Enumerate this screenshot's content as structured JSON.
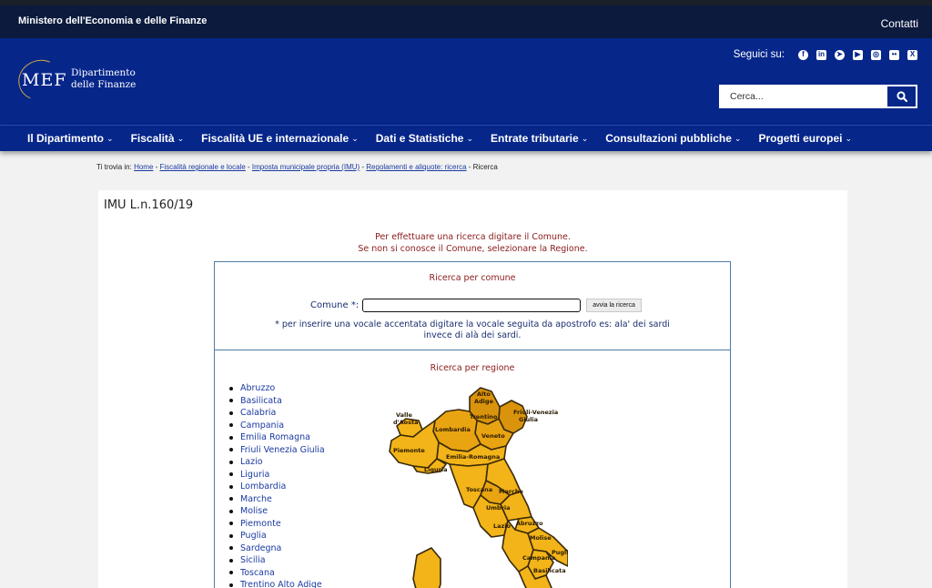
{
  "topbar": {
    "ministry": "Ministero dell'Economia e delle Finanze",
    "contact": "Contatti"
  },
  "header": {
    "logo_text": "MEF",
    "dept_line1": "Dipartimento",
    "dept_line2": "delle Finanze",
    "social_label": "Seguici su:",
    "social_icons": [
      "facebook-icon",
      "linkedin-icon",
      "telegram-icon",
      "youtube-icon",
      "instagram-icon",
      "flickr-icon",
      "x-icon"
    ],
    "search_placeholder": "Cerca..."
  },
  "nav": {
    "items": [
      "Il Dipartimento",
      "Fiscalità",
      "Fiscalità UE e internazionale",
      "Dati e Statistiche",
      "Entrate tributarie",
      "Consultazioni pubbliche",
      "Progetti europei"
    ],
    "chevron": "⌄"
  },
  "breadcrumb": {
    "prefix": "Ti trovia in:",
    "links": [
      "Home",
      "Fiscalità regionale e locale",
      "Imposta municipale propria (IMU)",
      "Regolamenti e aliquote: ricerca"
    ],
    "sep": " - ",
    "current": "Ricerca"
  },
  "page": {
    "title": "IMU L.n.160/19",
    "intro_line1": "Per effettuare una ricerca digitare il Comune.",
    "intro_line2": "Se non si conosce il Comune, selezionare la Regione.",
    "comune_section_title": "Ricerca per comune",
    "comune_label": "Comune *:",
    "comune_value": "",
    "search_button": "avvia la ricerca",
    "note_line1": "* per inserire una vocale accentata digitare la vocale seguita da apostrofo es: ala' dei sardi",
    "note_line2": "invece di alà dei sardi.",
    "region_section_title": "Ricerca per regione",
    "regions": [
      "Abruzzo",
      "Basilicata",
      "Calabria",
      "Campania",
      "Emilia Romagna",
      "Friuli Venezia Giulia",
      "Lazio",
      "Liguria",
      "Lombardia",
      "Marche",
      "Molise",
      "Piemonte",
      "Puglia",
      "Sardegna",
      "Sicilia",
      "Toscana",
      "Trentino Alto Adige"
    ]
  },
  "map_labels": {
    "alto": "Alto",
    "adige": "Adige",
    "trentino": "Trentino",
    "friuli": "Friuli-Venezia",
    "giulia": "Giulia",
    "valle": "Valle",
    "aosta": "d'Aosta",
    "lombardia": "Lombardia",
    "veneto": "Veneto",
    "piemonte": "Piemonte",
    "emilia": "Emilia-Romagna",
    "liguria": "Liguria",
    "toscana": "Toscana",
    "marche": "Marche",
    "umbria": "Umbria",
    "abruzzo": "Abruzzo",
    "lazio": "Lazio",
    "molise": "Molise",
    "campania": "Campania",
    "puglia": "Puglia",
    "basilicata": "Basilicata"
  },
  "colors": {
    "topbar": "#0b1a3d",
    "brand_blue": "#06268a",
    "accent_gold": "#c9a645",
    "map_fill": "#f2b418",
    "map_fill_dark": "#d9930c",
    "text_red": "#8b1a1a"
  }
}
